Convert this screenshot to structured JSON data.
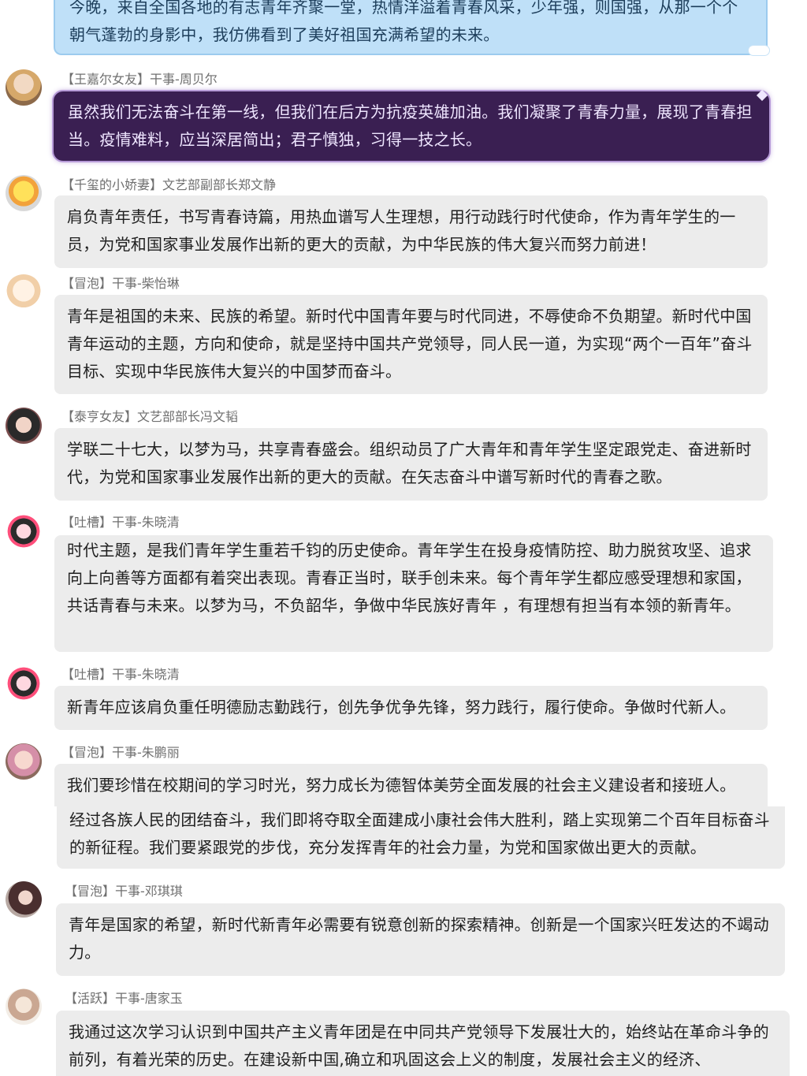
{
  "messages": [
    {
      "id": "m0",
      "tag": "",
      "name": "",
      "text": "今晚，来自全国各地的有志青年齐聚一堂，热情洋溢着青春风采，少年强，则国强，从那一个个朝气蓬勃的身影中，我仿佛看到了美好祖国充满希望的未来。"
    },
    {
      "id": "m1",
      "tag": "【王嘉尔女友】",
      "name": "干事-周贝尔",
      "text": "虽然我们无法奋斗在第一线，但我们在后方为抗疫英雄加油。我们凝聚了青春力量，展现了青春担当。疫情难料，应当深居简出；君子慎独，习得一技之长。"
    },
    {
      "id": "m2",
      "tag": "【千玺的小娇妻】",
      "name": "文艺部副部长郑文静",
      "text": "肩负青年责任，书写青春诗篇，用热血谱写人生理想，用行动践行时代使命，作为青年学生的一员，为党和国家事业发展作出新的更大的贡献，为中华民族的伟大复兴而努力前进！"
    },
    {
      "id": "m3",
      "tag": "【冒泡】",
      "name": "干事-柴怡琳",
      "text": "青年是祖国的未来、民族的希望。新时代中国青年要与时代同进，不辱使命不负期望。新时代中国青年运动的主题，方向和使命，就是坚持中国共产党领导，同人民一道，为实现“两个一百年”奋斗目标、实现中华民族伟大复兴的中国梦而奋斗。"
    },
    {
      "id": "m4",
      "tag": "【泰亨女友】",
      "name": "文艺部部长冯文韬",
      "text": "学联二十七大，以梦为马，共享青春盛会。组织动员了广大青年和青年学生坚定跟党走、奋进新时代，为党和国家事业发展作出新的更大的贡献。在矢志奋斗中谱写新时代的青春之歌。"
    },
    {
      "id": "m5",
      "tag": "【吐槽】",
      "name": "干事-朱晓清",
      "text": "时代主题，是我们青年学生重若千钧的历史使命。青年学生在投身疫情防控、助力脱贫攻坚、追求向上向善等方面都有着突出表现。青春正当时，联手创未来。每个青年学生都应感受理想和家国，共话青春与未来。以梦为马，不负韶华，争做中华民族好青年 ，有理想有担当有本领的新青年。"
    },
    {
      "id": "m6",
      "tag": "【吐槽】",
      "name": "干事-朱晓清",
      "text": "新青年应该肩负重任明德励志勤践行，创先争优争先锋，努力践行，履行使命。争做时代新人。"
    },
    {
      "id": "m7",
      "tag": "【冒泡】",
      "name": "干事-朱鹏丽",
      "text": "我们要珍惜在校期间的学习时光，努力成长为德智体美劳全面发展的社会主义建设者和接班人。",
      "text_continued": "经过各族人民的团结奋斗，我们即将夺取全面建成小康社会伟大胜利，踏上实现第二个百年目标奋斗的新征程。我们要紧跟党的步伐，充分发挥青年的社会力量，为党和国家做出更大的贡献。"
    },
    {
      "id": "m8",
      "tag": "【冒泡】",
      "name": "干事-邓琪琪",
      "text": "青年是国家的希望，新时代新青年必需要有锐意创新的探索精神。创新是一个国家兴旺发达的不竭动力。"
    },
    {
      "id": "m9",
      "tag": "【活跃】",
      "name": "干事-唐家玉",
      "text": "我通过这次学习认识到中国共产主义青年团是在中同共产党领导下发展壮大的，始终站在革命斗争的前列，有着光荣的历史。在建设新中国,确立和巩固这会上义的制度，发展社会主义的经济、"
    }
  ],
  "icons": {
    "m1": "avatar-blonde",
    "m2": "avatar-duck",
    "m3": "avatar-sketch",
    "m4": "avatar-girl",
    "m5": "avatar-chibi",
    "m6": "avatar-chibi",
    "m7": "avatar-doll",
    "m8": "avatar-dark",
    "m9": "avatar-art"
  },
  "colors": {
    "bubble_gray": "#ececec",
    "bubble_blue": "#bfe0f8",
    "bubble_purple": "#3a1f52",
    "sender_text": "#6f6f6f"
  }
}
